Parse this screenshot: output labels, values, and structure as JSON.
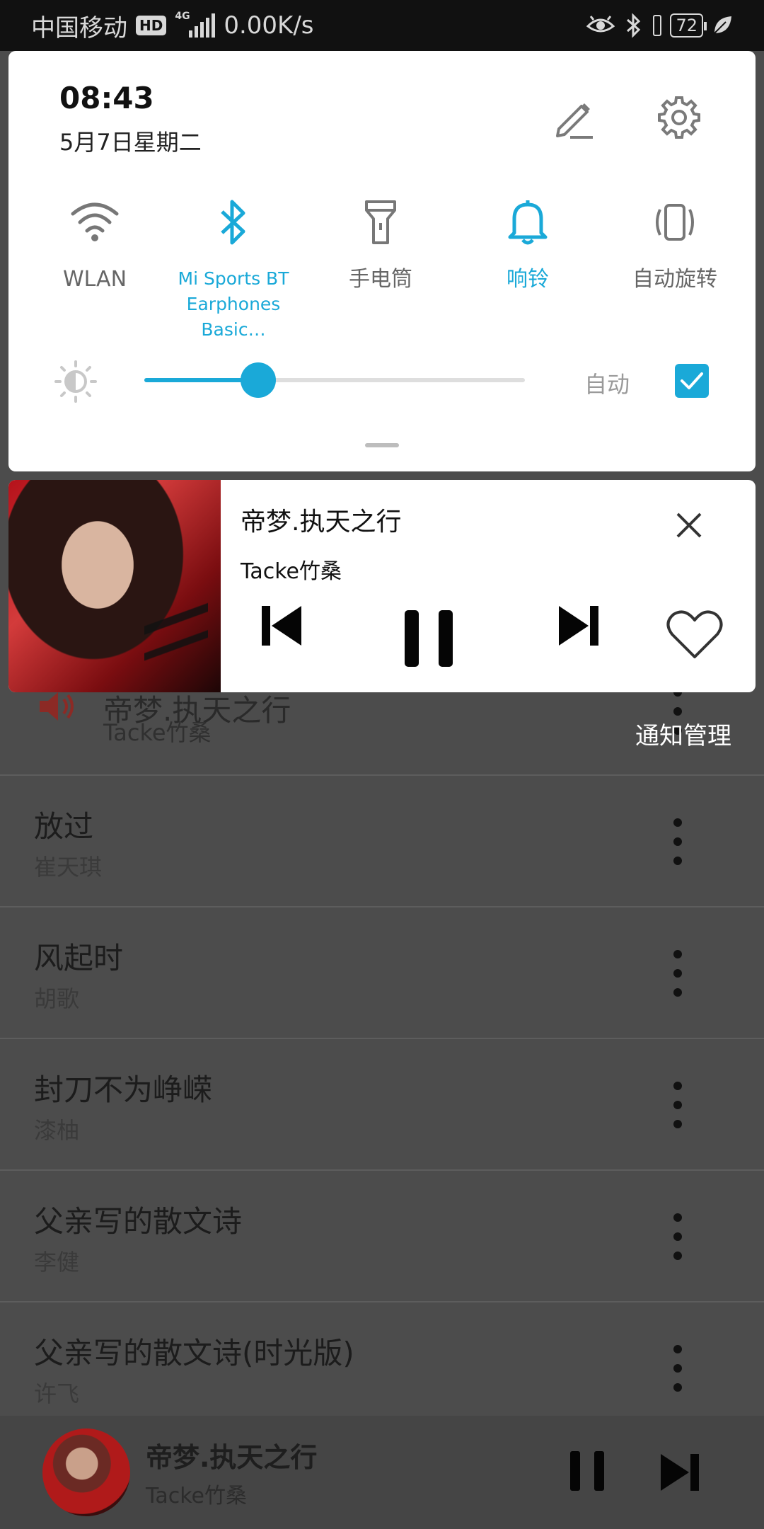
{
  "status_bar": {
    "carrier": "中国移动",
    "hd": "HD",
    "network_type": "4G",
    "speed": "0.00K/s",
    "battery": "72"
  },
  "quick_settings": {
    "time": "08:43",
    "date": "5月7日星期二",
    "tiles": [
      {
        "label": "WLAN",
        "icon": "wifi-icon",
        "active": false
      },
      {
        "label": "Mi Sports BT\nEarphones Basic…",
        "icon": "bluetooth-icon",
        "active": true
      },
      {
        "label": "手电筒",
        "icon": "flashlight-icon",
        "active": false
      },
      {
        "label": "响铃",
        "icon": "bell-icon",
        "active": true
      },
      {
        "label": "自动旋转",
        "icon": "rotate-icon",
        "active": false
      }
    ],
    "brightness_level": 0.3,
    "auto_label": "自动",
    "auto_checked": true,
    "accent": "#1aa9d8"
  },
  "media_notification": {
    "title": "帝梦.执天之行",
    "artist": "Tacke竹桑",
    "state": "playing"
  },
  "notification_management": "通知管理",
  "song_list": {
    "now_playing": {
      "title": "帝梦.执天之行",
      "artist": "Tacke竹桑"
    },
    "songs": [
      {
        "title": "放过",
        "artist": "崔天琪"
      },
      {
        "title": "风起时",
        "artist": "胡歌"
      },
      {
        "title": "封刀不为峥嵘",
        "artist": "漆柚"
      },
      {
        "title": "父亲写的散文诗",
        "artist": "李健"
      },
      {
        "title": "父亲写的散文诗(时光版)",
        "artist": "许飞"
      }
    ]
  },
  "mini_player": {
    "title": "帝梦.执天之行",
    "artist": "Tacke竹桑"
  }
}
